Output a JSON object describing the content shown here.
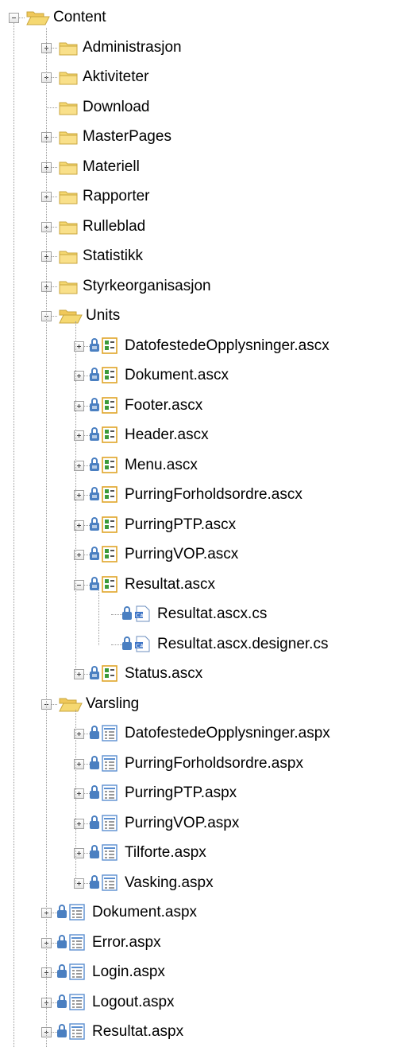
{
  "tree": {
    "root": {
      "label": "Content",
      "expanded": true
    },
    "items": [
      {
        "label": "Administrasjon",
        "type": "folder",
        "expander": "plus"
      },
      {
        "label": "Aktiviteter",
        "type": "folder",
        "expander": "plus"
      },
      {
        "label": "Download",
        "type": "folder",
        "expander": "none"
      },
      {
        "label": "MasterPages",
        "type": "folder",
        "expander": "plus"
      },
      {
        "label": "Materiell",
        "type": "folder",
        "expander": "plus"
      },
      {
        "label": "Rapporter",
        "type": "folder",
        "expander": "plus"
      },
      {
        "label": "Rulleblad",
        "type": "folder",
        "expander": "plus"
      },
      {
        "label": "Statistikk",
        "type": "folder",
        "expander": "plus"
      },
      {
        "label": "Styrkeorganisasjon",
        "type": "folder",
        "expander": "plus"
      },
      {
        "label": "Units",
        "type": "folder-open",
        "expander": "minus",
        "children": [
          {
            "label": "DatofestedeOpplysninger.ascx",
            "type": "control",
            "expander": "plus"
          },
          {
            "label": "Dokument.ascx",
            "type": "control",
            "expander": "plus"
          },
          {
            "label": "Footer.ascx",
            "type": "control",
            "expander": "plus"
          },
          {
            "label": "Header.ascx",
            "type": "control",
            "expander": "plus"
          },
          {
            "label": "Menu.ascx",
            "type": "control",
            "expander": "plus"
          },
          {
            "label": "PurringForholdsordre.ascx",
            "type": "control",
            "expander": "plus"
          },
          {
            "label": "PurringPTP.ascx",
            "type": "control",
            "expander": "plus"
          },
          {
            "label": "PurringVOP.ascx",
            "type": "control",
            "expander": "plus"
          },
          {
            "label": "Resultat.ascx",
            "type": "control",
            "expander": "minus",
            "children": [
              {
                "label": "Resultat.ascx.cs",
                "type": "cs"
              },
              {
                "label": "Resultat.ascx.designer.cs",
                "type": "cs"
              }
            ]
          },
          {
            "label": "Status.ascx",
            "type": "control",
            "expander": "plus"
          }
        ]
      },
      {
        "label": "Varsling",
        "type": "folder-open",
        "expander": "minus",
        "children": [
          {
            "label": "DatofestedeOpplysninger.aspx",
            "type": "page",
            "expander": "plus"
          },
          {
            "label": "PurringForholdsordre.aspx",
            "type": "page",
            "expander": "plus"
          },
          {
            "label": "PurringPTP.aspx",
            "type": "page",
            "expander": "plus"
          },
          {
            "label": "PurringVOP.aspx",
            "type": "page",
            "expander": "plus"
          },
          {
            "label": "Tilforte.aspx",
            "type": "page",
            "expander": "plus"
          },
          {
            "label": "Vasking.aspx",
            "type": "page",
            "expander": "plus"
          }
        ]
      },
      {
        "label": "Dokument.aspx",
        "type": "page",
        "expander": "plus"
      },
      {
        "label": "Error.aspx",
        "type": "page",
        "expander": "plus"
      },
      {
        "label": "Login.aspx",
        "type": "page",
        "expander": "plus"
      },
      {
        "label": "Logout.aspx",
        "type": "page",
        "expander": "plus"
      },
      {
        "label": "Resultat.aspx",
        "type": "page",
        "expander": "plus"
      }
    ]
  },
  "colors": {
    "folder_fill": "#f5d871",
    "folder_edge": "#c9a63d",
    "lock": "#4a7fc1",
    "control_border": "#e0a528",
    "control_green": "#3a9a3a",
    "page_blue": "#5b8fd0",
    "tree_lines": "#9a9a9a"
  }
}
